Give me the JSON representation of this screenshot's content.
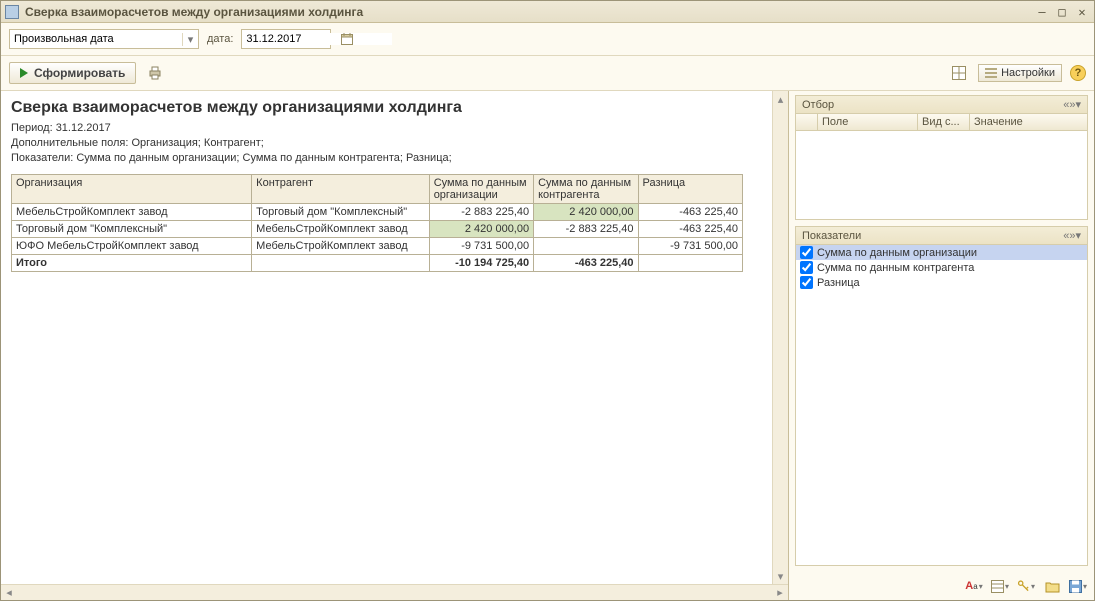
{
  "window": {
    "title": "Сверка взаиморасчетов между организациями холдинга"
  },
  "parambar": {
    "period_mode": "Произвольная дата",
    "date_label": "дата:",
    "date_value": "31.12.2017"
  },
  "toolbar": {
    "form_button": "Сформировать",
    "settings_button": "Настройки"
  },
  "report": {
    "title": "Сверка взаиморасчетов между организациями холдинга",
    "period_line": "Период: 31.12.2017",
    "fields_line": "Дополнительные поля: Организация; Контрагент;",
    "indicators_line": "Показатели: Сумма по данным организации; Сумма по данным контрагента; Разница;",
    "columns": {
      "org": "Организация",
      "contragent": "Контрагент",
      "sum_org": "Сумма по данным организации",
      "sum_contr": "Сумма по данным контрагента",
      "diff": "Разница"
    },
    "rows": [
      {
        "org": "МебельСтройКомплект завод",
        "contr": "Торговый дом \"Комплексный\"",
        "sum_org": "-2 883 225,40",
        "sum_contr": "2 420 000,00",
        "diff": "-463 225,40"
      },
      {
        "org": "Торговый дом \"Комплексный\"",
        "contr": "МебельСтройКомплект завод",
        "sum_org": "2 420 000,00",
        "sum_contr": "-2 883 225,40",
        "diff": "-463 225,40"
      },
      {
        "org": "ЮФО МебельСтройКомплект завод",
        "contr": "МебельСтройКомплект завод",
        "sum_org": "-9 731 500,00",
        "sum_contr": "",
        "diff": "-9 731 500,00"
      }
    ],
    "total": {
      "label": "Итого",
      "sum_org": "-10 194 725,40",
      "sum_contr": "-463 225,40",
      "diff": ""
    }
  },
  "right": {
    "filter": {
      "title": "Отбор",
      "cols": {
        "pole": "Поле",
        "vid": "Вид с...",
        "val": "Значение"
      }
    },
    "indicators": {
      "title": "Показатели",
      "items": [
        {
          "label": "Сумма по данным организации",
          "checked": true,
          "selected": true
        },
        {
          "label": "Сумма по данным контрагента",
          "checked": true,
          "selected": false
        },
        {
          "label": "Разница",
          "checked": true,
          "selected": false
        }
      ]
    }
  }
}
